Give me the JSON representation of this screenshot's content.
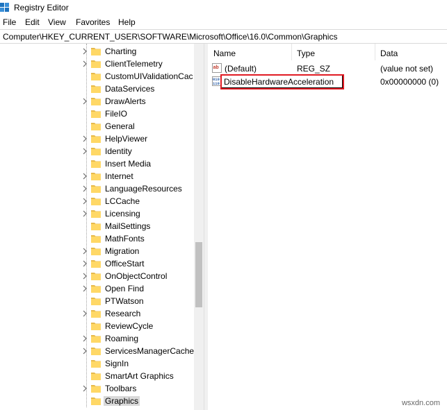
{
  "window": {
    "title": "Registry Editor",
    "app_icon": "registry-icon"
  },
  "menu": [
    "File",
    "Edit",
    "View",
    "Favorites",
    "Help"
  ],
  "address": "Computer\\HKEY_CURRENT_USER\\SOFTWARE\\Microsoft\\Office\\16.0\\Common\\Graphics",
  "tree": {
    "items": [
      {
        "label": "Charting",
        "expandable": true
      },
      {
        "label": "ClientTelemetry",
        "expandable": true
      },
      {
        "label": "CustomUIValidationCac",
        "expandable": false
      },
      {
        "label": "DataServices",
        "expandable": false
      },
      {
        "label": "DrawAlerts",
        "expandable": true
      },
      {
        "label": "FileIO",
        "expandable": false
      },
      {
        "label": "General",
        "expandable": false
      },
      {
        "label": "HelpViewer",
        "expandable": true
      },
      {
        "label": "Identity",
        "expandable": true
      },
      {
        "label": "Insert Media",
        "expandable": false
      },
      {
        "label": "Internet",
        "expandable": true
      },
      {
        "label": "LanguageResources",
        "expandable": true
      },
      {
        "label": "LCCache",
        "expandable": true
      },
      {
        "label": "Licensing",
        "expandable": true
      },
      {
        "label": "MailSettings",
        "expandable": false
      },
      {
        "label": "MathFonts",
        "expandable": false
      },
      {
        "label": "Migration",
        "expandable": true
      },
      {
        "label": "OfficeStart",
        "expandable": true
      },
      {
        "label": "OnObjectControl",
        "expandable": true
      },
      {
        "label": "Open Find",
        "expandable": true
      },
      {
        "label": "PTWatson",
        "expandable": false
      },
      {
        "label": "Research",
        "expandable": true
      },
      {
        "label": "ReviewCycle",
        "expandable": false
      },
      {
        "label": "Roaming",
        "expandable": true
      },
      {
        "label": "ServicesManagerCache",
        "expandable": true
      },
      {
        "label": "SignIn",
        "expandable": false
      },
      {
        "label": "SmartArt Graphics",
        "expandable": false
      },
      {
        "label": "Toolbars",
        "expandable": true
      },
      {
        "label": "Graphics",
        "expandable": false,
        "selected": true
      }
    ]
  },
  "columns": {
    "name": "Name",
    "type": "Type",
    "data": "Data"
  },
  "values": [
    {
      "icon": "string-value-icon",
      "name": "(Default)",
      "type": "REG_SZ",
      "data": "(value not set)"
    },
    {
      "icon": "dword-value-icon",
      "name": "DisableHardwareAcceleration",
      "type": "",
      "data": "0x00000000 (0)",
      "editing": true
    }
  ],
  "watermark": "wsxdn.com",
  "colors": {
    "highlight": "#e01a22",
    "folder": "#ffd866",
    "folder_dark": "#e6b94a"
  }
}
